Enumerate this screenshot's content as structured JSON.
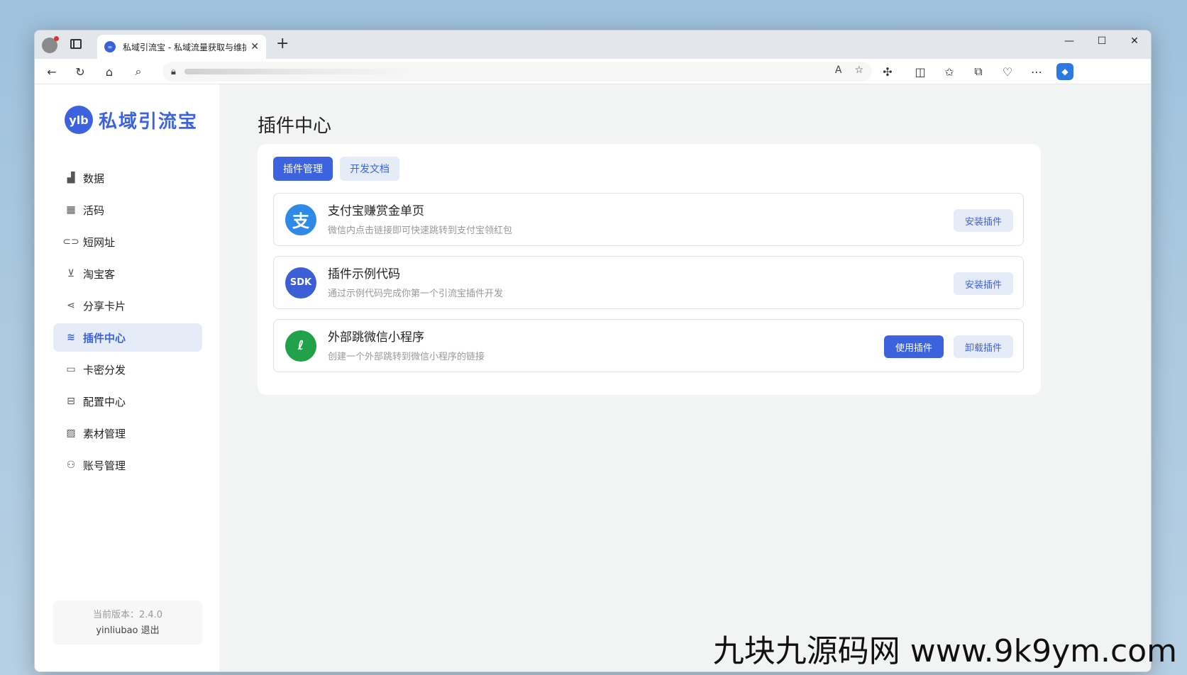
{
  "browser": {
    "tab_title": "私域引流宝 - 私域流量获取与维护",
    "new_tab": "+",
    "win_min": "—",
    "win_max": "☐",
    "win_close": "✕"
  },
  "app": {
    "logo_badge": "ylb",
    "logo_text": "私域引流宝",
    "nav": [
      {
        "label": "数据",
        "icon": "chart-icon"
      },
      {
        "label": "活码",
        "icon": "grid-icon"
      },
      {
        "label": "短网址",
        "icon": "link-icon"
      },
      {
        "label": "淘宝客",
        "icon": "cart-icon"
      },
      {
        "label": "分享卡片",
        "icon": "share-icon"
      },
      {
        "label": "插件中心",
        "icon": "layers-icon",
        "active": true
      },
      {
        "label": "卡密分发",
        "icon": "card-icon"
      },
      {
        "label": "配置中心",
        "icon": "config-icon"
      },
      {
        "label": "素材管理",
        "icon": "image-icon"
      },
      {
        "label": "账号管理",
        "icon": "user-icon"
      }
    ],
    "version": "当前版本：2.4.0",
    "username": "yinliubao",
    "logout": "退出"
  },
  "main": {
    "page_title": "插件中心",
    "tabs": [
      "插件管理",
      "开发文档"
    ],
    "plugins": [
      {
        "name": "支付宝赚赏金单页",
        "desc": "微信内点击链接即可快速跳转到支付宝领红包",
        "icon_text": "支",
        "actions": [
          "安装插件"
        ]
      },
      {
        "name": "插件示例代码",
        "desc": "通过示例代码完成你第一个引流宝插件开发",
        "icon_text": "SDK",
        "actions": [
          "安装插件"
        ]
      },
      {
        "name": "外部跳微信小程序",
        "desc": "创建一个外部跳转到微信小程序的链接",
        "icon_text": "ℓ",
        "actions": [
          "使用插件",
          "卸载插件"
        ]
      }
    ]
  },
  "watermark": "九块九源码网 www.9k9ym.com",
  "colors": {
    "accent": "#3c63dd",
    "accent_light": "#e6ebf8",
    "alipay": "#2e8ae6",
    "wechat": "#22a14b"
  }
}
